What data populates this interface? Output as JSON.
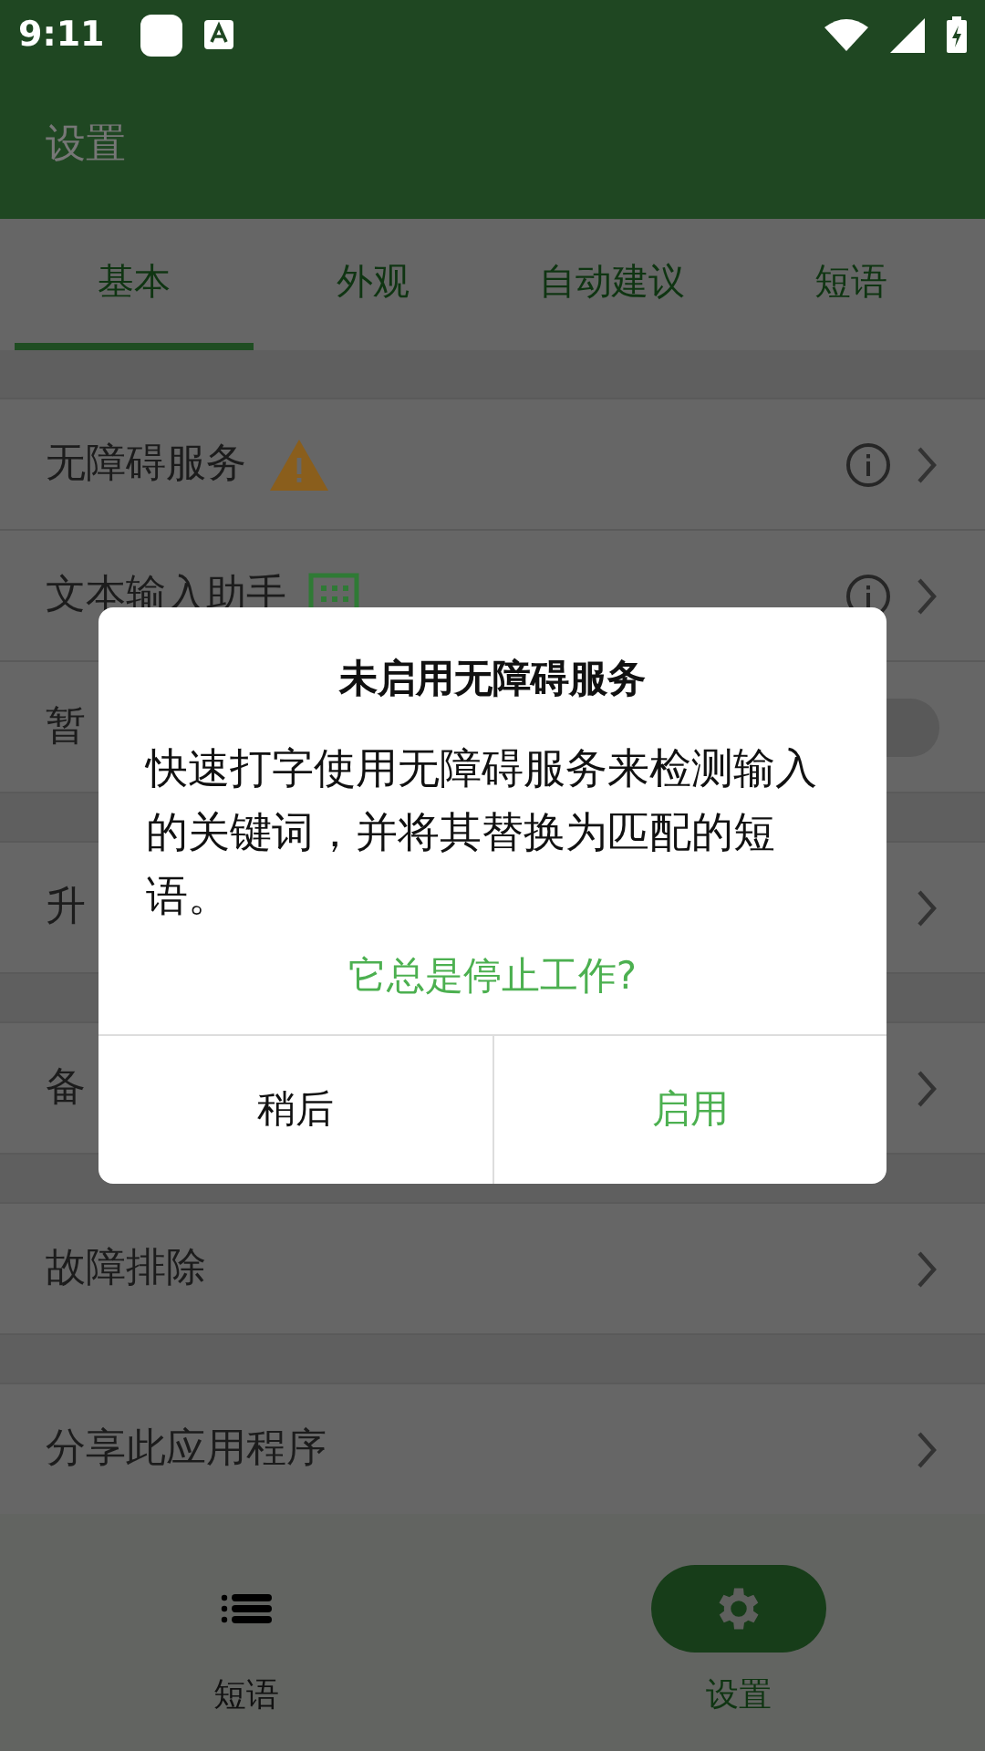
{
  "status_bar": {
    "time": "9:11"
  },
  "app_bar": {
    "title": "设置"
  },
  "tabs": [
    {
      "label": "基本",
      "selected": true
    },
    {
      "label": "外观",
      "selected": false
    },
    {
      "label": "自动建议",
      "selected": false
    },
    {
      "label": "短语",
      "selected": false
    }
  ],
  "sections": [
    {
      "rows": [
        {
          "label": "无障碍服务",
          "kind": "warning"
        },
        {
          "label": "文本输入助手",
          "kind": "keyboard"
        },
        {
          "label": "暂",
          "kind": "toggle",
          "on": false
        }
      ]
    },
    {
      "rows": [
        {
          "label": "升",
          "kind": "link"
        }
      ]
    },
    {
      "rows": [
        {
          "label": "备",
          "kind": "link"
        }
      ]
    },
    {
      "rows": [
        {
          "label": "故障排除",
          "kind": "link"
        }
      ]
    },
    {
      "rows": [
        {
          "label": "分享此应用程序",
          "kind": "link"
        }
      ]
    }
  ],
  "bottom_nav": [
    {
      "label": "短语",
      "kind": "list",
      "selected": false
    },
    {
      "label": "设置",
      "kind": "gear",
      "selected": true
    }
  ],
  "dialog": {
    "title": "未启用无障碍服务",
    "message": "快速打字使用无障碍服务来检测输入的关键词，并将其替换为匹配的短语。",
    "link": "它总是停止工作?",
    "buttons": [
      {
        "label": "稍后",
        "kind": "neutral"
      },
      {
        "label": "启用",
        "kind": "primary"
      }
    ]
  }
}
